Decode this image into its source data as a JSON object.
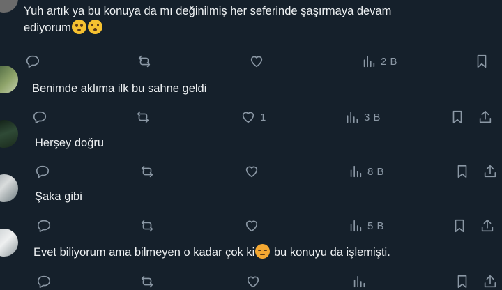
{
  "posts": [
    {
      "text_line1": "Yuh artık ya bu konuya da mı değinilmiş her seferinde şaşırmaya devam",
      "text_line2": "ediyorum",
      "emojis": [
        "pleading-face",
        "hushed-face"
      ],
      "like_count": "",
      "view_count": "2 B"
    },
    {
      "text": "Benimde aklıma ilk bu sahne geldi",
      "like_count": "1",
      "view_count": "3 B"
    },
    {
      "text": "Herşey doğru",
      "like_count": "",
      "view_count": "8 B"
    },
    {
      "text": "Şaka gibi",
      "like_count": "",
      "view_count": "5 B"
    },
    {
      "text_before": "Evet biliyorum ama bilmeyen o kadar çok ki",
      "emoji": "disappointed-face",
      "text_after": " bu konuyu da işlemişti."
    }
  ],
  "colors": {
    "background": "#15202b",
    "text": "#e7e9ea",
    "icon": "#8b98a5"
  }
}
